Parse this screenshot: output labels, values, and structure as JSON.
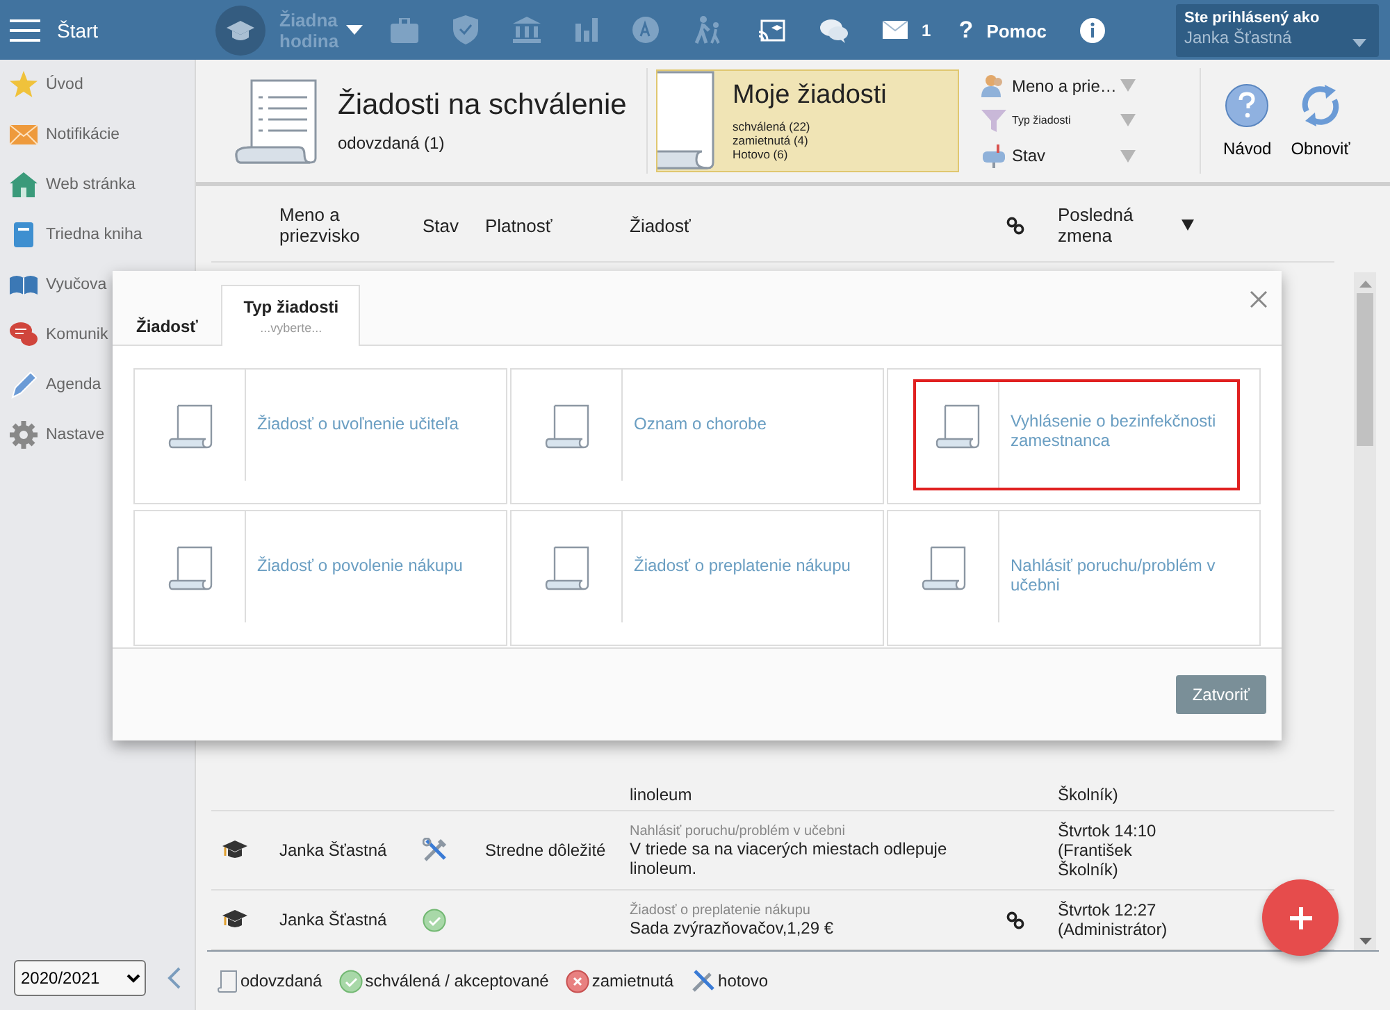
{
  "topbar": {
    "menu_label": "Štart",
    "lesson": "Žiadna hodina",
    "messages_count": "1",
    "help_icon": "?",
    "help": "Pomoc",
    "user_caption": "Ste prihlásený ako",
    "user_name": "Janka Šťastná"
  },
  "sidebar": {
    "items": [
      {
        "label": "Úvod"
      },
      {
        "label": "Notifikácie"
      },
      {
        "label": "Web stránka"
      },
      {
        "label": "Triedna kniha"
      },
      {
        "label": "Vyučova"
      },
      {
        "label": "Komunik"
      },
      {
        "label": "Agenda"
      },
      {
        "label": "Nastave"
      }
    ],
    "year": "2020/2021"
  },
  "header": {
    "title": "Žiadosti na schválenie",
    "subtitle": "odovzdaná (1)",
    "mine": {
      "title": "Moje žiadosti",
      "counts": [
        "schválená (22)",
        "zamietnutá (4)",
        "Hotovo (6)"
      ]
    },
    "filters": [
      {
        "label": "Meno a prie…"
      },
      {
        "label": "Typ žiadosti"
      },
      {
        "label": "Stav"
      }
    ],
    "buttons": [
      {
        "label": "Návod"
      },
      {
        "label": "Obnoviť"
      }
    ]
  },
  "table": {
    "columns": [
      "Meno a priezvisko",
      "Stav",
      "Platnosť",
      "Žiadosť",
      "Posledná zmena"
    ],
    "partial_row": {
      "request": "linoleum",
      "changed": "Školník)"
    },
    "rows": [
      {
        "name": "Janka Šťastná",
        "done": true,
        "approved": false,
        "validity": "Stredne dôležité",
        "request_type": "Nahlásiť poruchu/problém v učebni",
        "request": "V triede sa na viacerých miestach odlepuje linoleum.",
        "linked": false,
        "changed": "Štvrtok 14:10 (František Školník)"
      },
      {
        "name": "Janka Šťastná",
        "done": false,
        "approved": true,
        "request_type": "Žiadosť o preplatenie nákupu",
        "request": "Sada zvýrazňovačov,1,29 €",
        "linked": true,
        "changed": "Štvrtok 12:27 (Administrátor)"
      }
    ]
  },
  "legend": [
    {
      "kind": "submitted",
      "label": "odovzdaná"
    },
    {
      "kind": "approved",
      "label": "schválená / akceptované"
    },
    {
      "kind": "rejected",
      "label": "zamietnutá"
    },
    {
      "kind": "done",
      "label": "hotovo"
    }
  ],
  "dialog": {
    "tabs": [
      {
        "label": "Žiadosť",
        "selected": false
      },
      {
        "label": "Typ žiadosti",
        "sub": "...vyberte...",
        "selected": true
      }
    ],
    "types": [
      {
        "label": "Žiadosť o uvoľnenie učiteľa",
        "highlighted": false
      },
      {
        "label": "Oznam o chorobe",
        "highlighted": false
      },
      {
        "label": "Vyhlásenie o bezinfekčnosti zamestnanca",
        "highlighted": true
      },
      {
        "label": "Žiadosť o povolenie nákupu",
        "highlighted": false
      },
      {
        "label": "Žiadosť o preplatenie nákupu",
        "highlighted": false
      },
      {
        "label": "Nahlásiť poruchu/problém v učebni",
        "highlighted": false
      }
    ],
    "close_button": "Zatvoriť"
  }
}
